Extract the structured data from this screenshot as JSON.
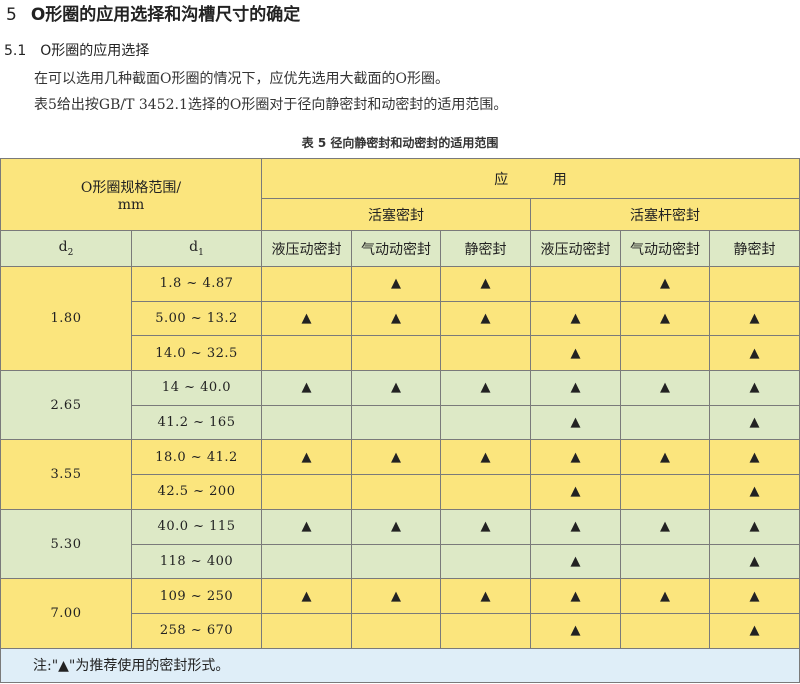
{
  "section": {
    "number": "5",
    "title": "O形圈的应用选择和沟槽尺寸的确定"
  },
  "subsection": {
    "number": "5.1",
    "title": "O形圈的应用选择"
  },
  "paragraphs": [
    "在可以选用几种截面O形圈的情况下，应优先选用大截面的O形圈。",
    "表5给出按GB/T 3452.1选择的O形圈对于径向静密封和动密封的适用范围。"
  ],
  "table": {
    "caption": "表 5   径向静密封和动密封的适用范围",
    "header": {
      "spec_range": "O形圈规格范围/",
      "spec_unit": "mm",
      "application": "应          用",
      "piston_seal": "活塞密封",
      "rod_seal": "活塞杆密封",
      "d2": "d",
      "d2_sub": "2",
      "d1": "d",
      "d1_sub": "1",
      "columns": [
        "液压动密封",
        "气动动密封",
        "静密封",
        "液压动密封",
        "气动动密封",
        "静密封"
      ]
    },
    "mark": "▲",
    "groups": [
      {
        "d2": "1.80",
        "color": "yellow",
        "rows": [
          {
            "d1": "1.8 ~ 4.87",
            "marks": [
              false,
              true,
              true,
              false,
              true,
              false
            ]
          },
          {
            "d1": "5.00 ~ 13.2",
            "marks": [
              true,
              true,
              true,
              true,
              true,
              true
            ]
          },
          {
            "d1": "14.0 ~ 32.5",
            "marks": [
              false,
              false,
              false,
              true,
              false,
              true
            ]
          }
        ]
      },
      {
        "d2": "2.65",
        "color": "green",
        "rows": [
          {
            "d1": "14 ~ 40.0",
            "marks": [
              true,
              true,
              true,
              true,
              true,
              true
            ]
          },
          {
            "d1": "41.2 ~ 165",
            "marks": [
              false,
              false,
              false,
              true,
              false,
              true
            ]
          }
        ]
      },
      {
        "d2": "3.55",
        "color": "yellow",
        "rows": [
          {
            "d1": "18.0 ~ 41.2",
            "marks": [
              true,
              true,
              true,
              true,
              true,
              true
            ]
          },
          {
            "d1": "42.5 ~ 200",
            "marks": [
              false,
              false,
              false,
              true,
              false,
              true
            ]
          }
        ]
      },
      {
        "d2": "5.30",
        "color": "green",
        "rows": [
          {
            "d1": "40.0 ~ 115",
            "marks": [
              true,
              true,
              true,
              true,
              true,
              true
            ]
          },
          {
            "d1": "118 ~ 400",
            "marks": [
              false,
              false,
              false,
              true,
              false,
              true
            ]
          }
        ]
      },
      {
        "d2": "7.00",
        "color": "yellow",
        "rows": [
          {
            "d1": "109 ~ 250",
            "marks": [
              true,
              true,
              true,
              true,
              true,
              true
            ]
          },
          {
            "d1": "258 ~ 670",
            "marks": [
              false,
              false,
              false,
              true,
              false,
              true
            ]
          }
        ]
      }
    ],
    "note": "注:\"▲\"为推荐使用的密封形式。"
  },
  "colors": {
    "yellow": "#fbe57d",
    "green": "#dde9c6",
    "note_bg": "#dfeef8",
    "border": "#7a7a7a"
  }
}
